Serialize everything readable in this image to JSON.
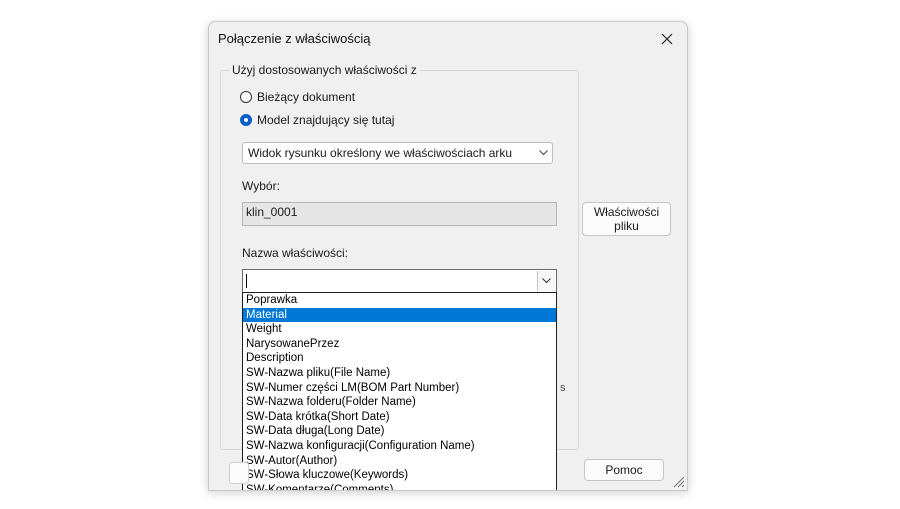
{
  "dialog": {
    "title": "Połączenie z właściwością",
    "group_label": "Użyj dostosowanych właściwości z",
    "radio_current": "Bieżący dokument",
    "radio_model": "Model znajdujący się tutaj",
    "view_combo_value": "Widok rysunku określony we właściwościach arku",
    "selection_label": "Wybór:",
    "selection_value": "klin_0001",
    "file_props_button": "Właściwości pliku",
    "property_name_label": "Nazwa właściwości:",
    "help_button": "Pomoc",
    "partial_text": "s"
  },
  "dropdown": {
    "items": [
      "Poprawka",
      "Material",
      "Weight",
      "NarysowanePrzez",
      "Description",
      "SW-Nazwa pliku(File Name)",
      "SW-Numer części LM(BOM Part Number)",
      "SW-Nazwa folderu(Folder Name)",
      "SW-Data krótka(Short Date)",
      "SW-Data długa(Long Date)",
      "SW-Nazwa konfiguracji(Configuration Name)",
      "SW-Autor(Author)",
      "SW-Słowa kluczowe(Keywords)",
      "SW-Komentarze(Comments)"
    ],
    "selected": "Material"
  },
  "icons": {
    "close": "close-icon",
    "chevron": "chevron-down-icon",
    "grip": "resize-grip-icon"
  },
  "colors": {
    "accent": "#0078d7",
    "radio_selected": "#0a5fc7"
  }
}
